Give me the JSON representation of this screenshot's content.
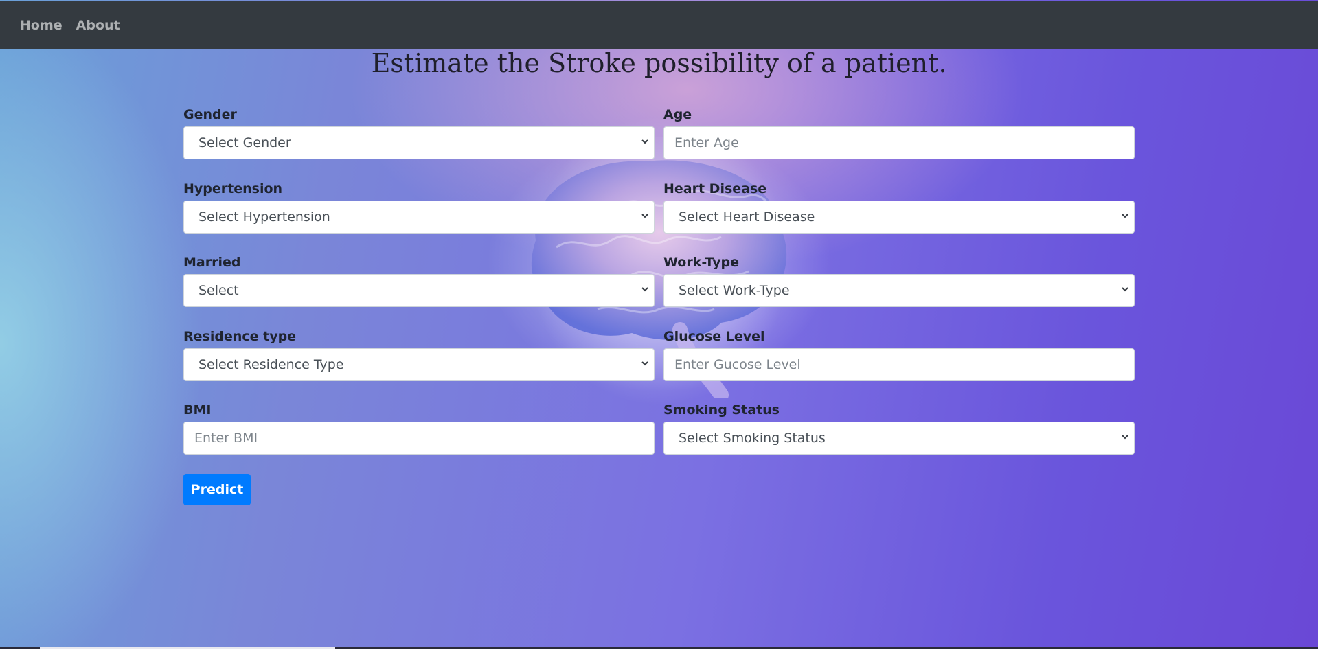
{
  "nav": {
    "items": [
      {
        "label": "Home"
      },
      {
        "label": "About"
      }
    ]
  },
  "page": {
    "title": "Estimate the Stroke possibility of a patient."
  },
  "form": {
    "gender": {
      "label": "Gender",
      "value": "Select Gender",
      "kind": "select"
    },
    "age": {
      "label": "Age",
      "placeholder": "Enter Age",
      "kind": "input"
    },
    "hypertension": {
      "label": "Hypertension",
      "value": "Select Hypertension",
      "kind": "select"
    },
    "heart_disease": {
      "label": "Heart Disease",
      "value": "Select Heart Disease",
      "kind": "select"
    },
    "married": {
      "label": "Married",
      "value": "Select",
      "kind": "select"
    },
    "work_type": {
      "label": "Work-Type",
      "value": "Select Work-Type",
      "kind": "select"
    },
    "residence_type": {
      "label": "Residence type",
      "value": "Select Residence Type",
      "kind": "select"
    },
    "glucose_level": {
      "label": "Glucose Level",
      "placeholder": "Enter Gucose Level",
      "kind": "input"
    },
    "bmi": {
      "label": "BMI",
      "placeholder": "Enter BMI",
      "kind": "input"
    },
    "smoking_status": {
      "label": "Smoking Status",
      "value": "Select Smoking Status",
      "kind": "select"
    },
    "submit_label": "Predict"
  },
  "colors": {
    "navbar": "#343a40",
    "primary_button": "#007bff",
    "background_accent": "#6a55dc"
  },
  "icons": {
    "select_arrow": "chevron-down-icon",
    "illustration": "brain-illustration"
  }
}
